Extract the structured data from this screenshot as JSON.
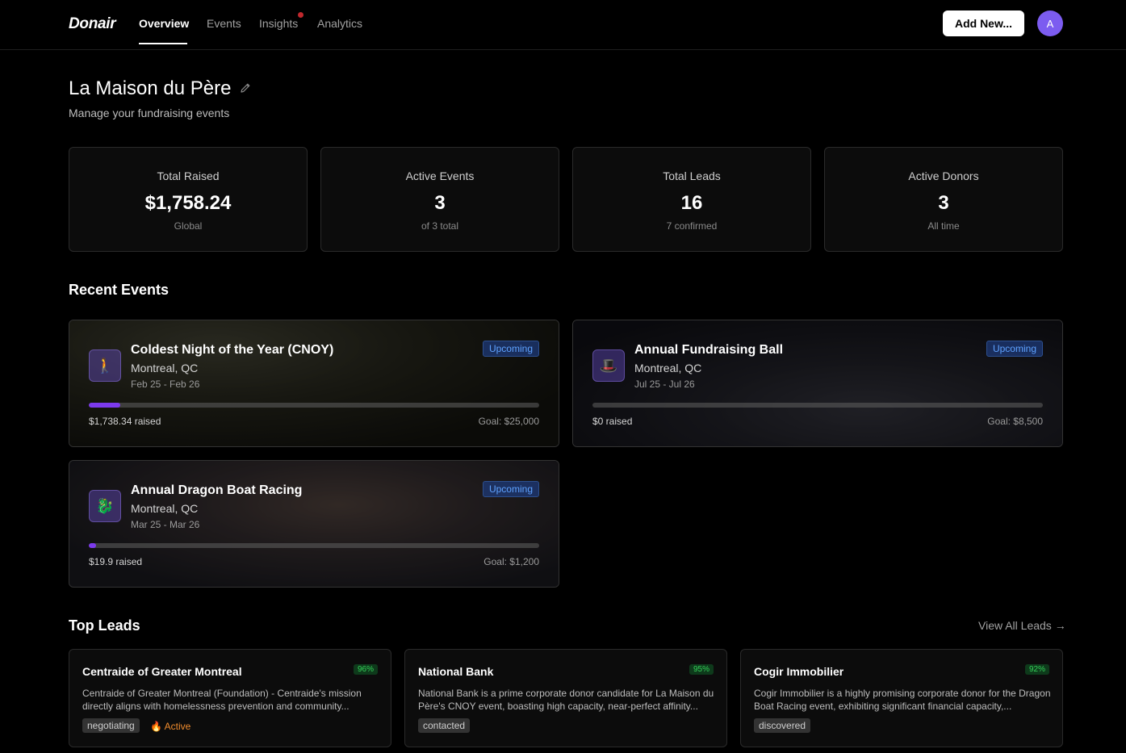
{
  "app": {
    "logo": "Donair",
    "tabs": [
      "Overview",
      "Events",
      "Insights",
      "Analytics"
    ],
    "add_button": "Add New...",
    "avatar_initial": "A"
  },
  "header": {
    "title": "La Maison du Père",
    "subtitle": "Manage your fundraising events"
  },
  "stats": [
    {
      "label": "Total Raised",
      "value": "$1,758.24",
      "sub": "Global"
    },
    {
      "label": "Active Events",
      "value": "3",
      "sub": "of 3 total"
    },
    {
      "label": "Total Leads",
      "value": "16",
      "sub": "7 confirmed"
    },
    {
      "label": "Active Donors",
      "value": "3",
      "sub": "All time"
    }
  ],
  "recent_events": {
    "title": "Recent Events",
    "items": [
      {
        "title": "Coldest Night of the Year (CNOY)",
        "location": "Montreal, QC",
        "dates": "Feb 25 - Feb 26",
        "status": "Upcoming",
        "raised": "$1,738.34 raised",
        "goal": "Goal: $25,000",
        "progress": 0.07,
        "icon": "walking-person-icon"
      },
      {
        "title": "Annual Fundraising Ball",
        "location": "Montreal, QC",
        "dates": "Jul 25 - Jul 26",
        "status": "Upcoming",
        "raised": "$0 raised",
        "goal": "Goal: $8,500",
        "progress": 0,
        "icon": "top-hat-icon"
      },
      {
        "title": "Annual Dragon Boat Racing",
        "location": "Montreal, QC",
        "dates": "Mar 25 - Mar 26",
        "status": "Upcoming",
        "raised": "$19.9 raised",
        "goal": "Goal: $1,200",
        "progress": 0.017,
        "icon": "dragon-icon"
      }
    ]
  },
  "top_leads": {
    "title": "Top Leads",
    "view_all": "View All Leads →",
    "items": [
      {
        "name": "Centraide of Greater Montreal",
        "score": "96%",
        "description": "Centraide of Greater Montreal (Foundation) - Centraide's mission directly aligns with homelessness prevention and community...",
        "tag": "negotiating",
        "active": "Active"
      },
      {
        "name": "National Bank",
        "score": "95%",
        "description": "National Bank is a prime corporate donor candidate for La Maison du Père's CNOY event, boasting high capacity, near-perfect affinity...",
        "tag": "contacted"
      },
      {
        "name": "Cogir Immobilier",
        "score": "92%",
        "description": "Cogir Immobilier is a highly promising corporate donor for the Dragon Boat Racing event, exhibiting significant financial capacity,...",
        "tag": "discovered"
      }
    ]
  },
  "colors": {
    "accent": "#7c3aed",
    "badge_blue": "#5ea2ff",
    "score_green": "#34d058",
    "active_orange": "#f08c2e"
  }
}
